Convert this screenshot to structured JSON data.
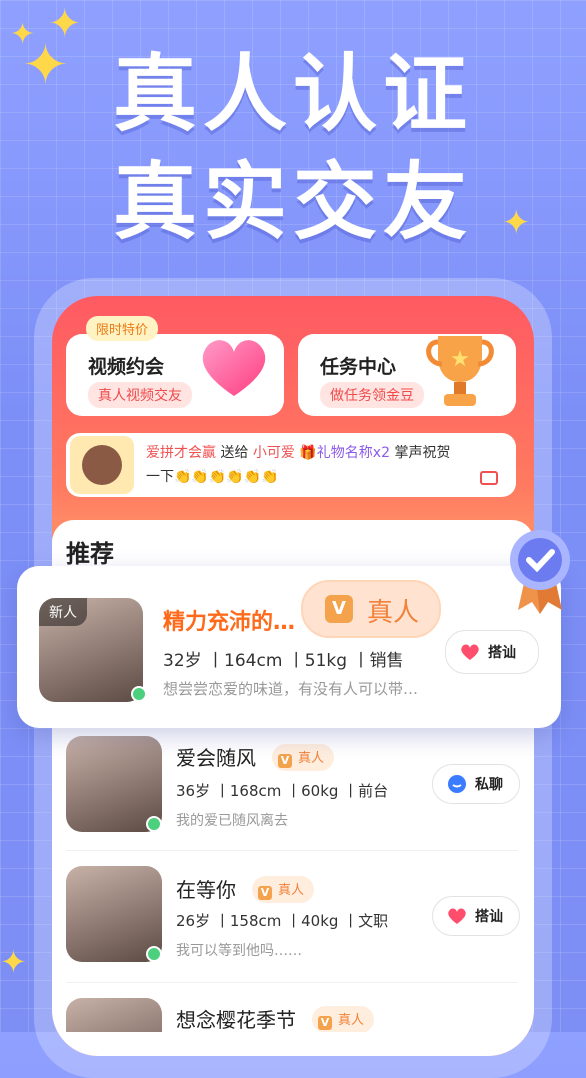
{
  "headline": {
    "line1": "真人认证",
    "line2": "真实交友"
  },
  "features": [
    {
      "tag": "限时特价",
      "title": "视频约会",
      "subtitle": "真人视频交友",
      "icon": "heart-icon"
    },
    {
      "title": "任务中心",
      "subtitle": "做任务领金豆",
      "icon": "trophy-icon"
    }
  ],
  "gift_banner": {
    "sender": "爱拼才会赢",
    "verb": "送给",
    "receiver": "小可爱",
    "gift": "礼物名称x2",
    "tail": "掌声祝贺",
    "tail2": "一下👏👏👏👏👏👏"
  },
  "section_title": "推荐",
  "featured_user": {
    "badge": "新人",
    "name": "精力充沛的…",
    "verified": "真人",
    "info": "32岁 丨164cm 丨51kg 丨销售",
    "bio": "想尝尝恋爱的味道，有没有人可以带…",
    "action": "搭讪"
  },
  "users": [
    {
      "name": "爱会随风",
      "verified": "真人",
      "info": "36岁 丨168cm 丨60kg 丨前台",
      "bio": "我的爱已随风离去",
      "action": "私聊"
    },
    {
      "name": "在等你",
      "verified": "真人",
      "info": "26岁 丨158cm 丨40kg 丨文职",
      "bio": "我可以等到他吗……",
      "action": "搭讪"
    },
    {
      "name": "想念樱花季节",
      "verified": "真人"
    }
  ],
  "colors": {
    "accent": "#ff5a62",
    "verified": "#f2813a",
    "online": "#4cd07d"
  }
}
